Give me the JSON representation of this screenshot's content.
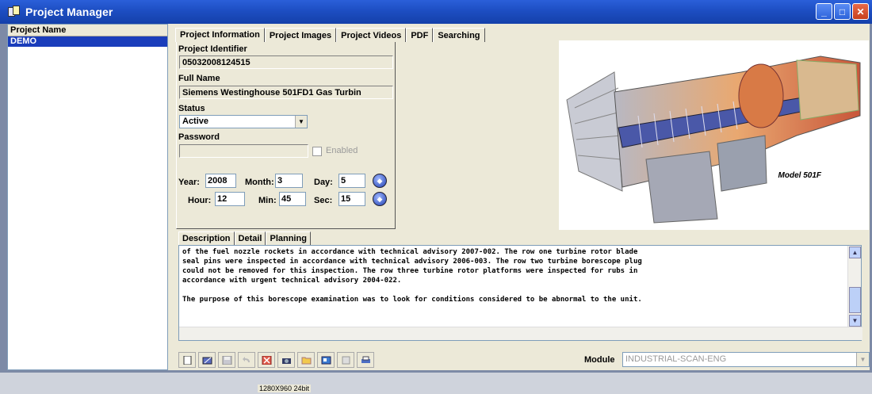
{
  "window": {
    "title": "Project Manager",
    "buttons": [
      "minimize",
      "maximize",
      "close"
    ]
  },
  "project_list": {
    "header": "Project Name",
    "items": [
      {
        "label": "DEMO",
        "selected": true
      }
    ]
  },
  "tabs": [
    {
      "label": "Project Information",
      "active": true
    },
    {
      "label": "Project Images"
    },
    {
      "label": "Project Videos"
    },
    {
      "label": "PDF"
    },
    {
      "label": "Searching"
    }
  ],
  "project_info": {
    "identifier_label": "Project Identifier",
    "identifier": "05032008124515",
    "full_name_label": "Full Name",
    "full_name": "Siemens Westinghouse 501FD1 Gas Turbin",
    "status_label": "Status",
    "status": "Active",
    "password_label": "Password",
    "password_value": "",
    "enabled_label": "Enabled",
    "enabled": false,
    "date": {
      "year_label": "Year:",
      "year": "2008",
      "month_label": "Month:",
      "month": "3",
      "day_label": "Day:",
      "day": "5"
    },
    "time": {
      "hour_label": "Hour:",
      "hour": "12",
      "min_label": "Min:",
      "min": "45",
      "sec_label": "Sec:",
      "sec": "15"
    }
  },
  "image": {
    "caption": "Model 501F"
  },
  "sub_tabs": [
    {
      "label": "Description",
      "active": true
    },
    {
      "label": "Detail"
    },
    {
      "label": "Planning"
    }
  ],
  "description": "of the fuel nozzle rockets in accordance with technical advisory 2007-002. The row one turbine rotor blade\nseal pins were inspected in accordance with technical advisory 2006-003. The row two turbine borescope plug\ncould not be removed for this inspection. The row three turbine rotor platforms were inspected for rubs in\naccordance with urgent technical advisory 2004-022.\n\nThe purpose of this borescope examination was to look for conditions considered to be abnormal to the unit.",
  "toolbar": {
    "buttons": [
      "new-icon",
      "edit-icon",
      "save-icon",
      "undo-icon",
      "delete-icon",
      "camera-icon",
      "folder-icon",
      "export-icon",
      "import-icon",
      "print-icon"
    ],
    "module_label": "Module",
    "module_value": "INDUSTRIAL-SCAN-ENG"
  },
  "status_bar": {
    "text": "1280X960 24bit"
  }
}
